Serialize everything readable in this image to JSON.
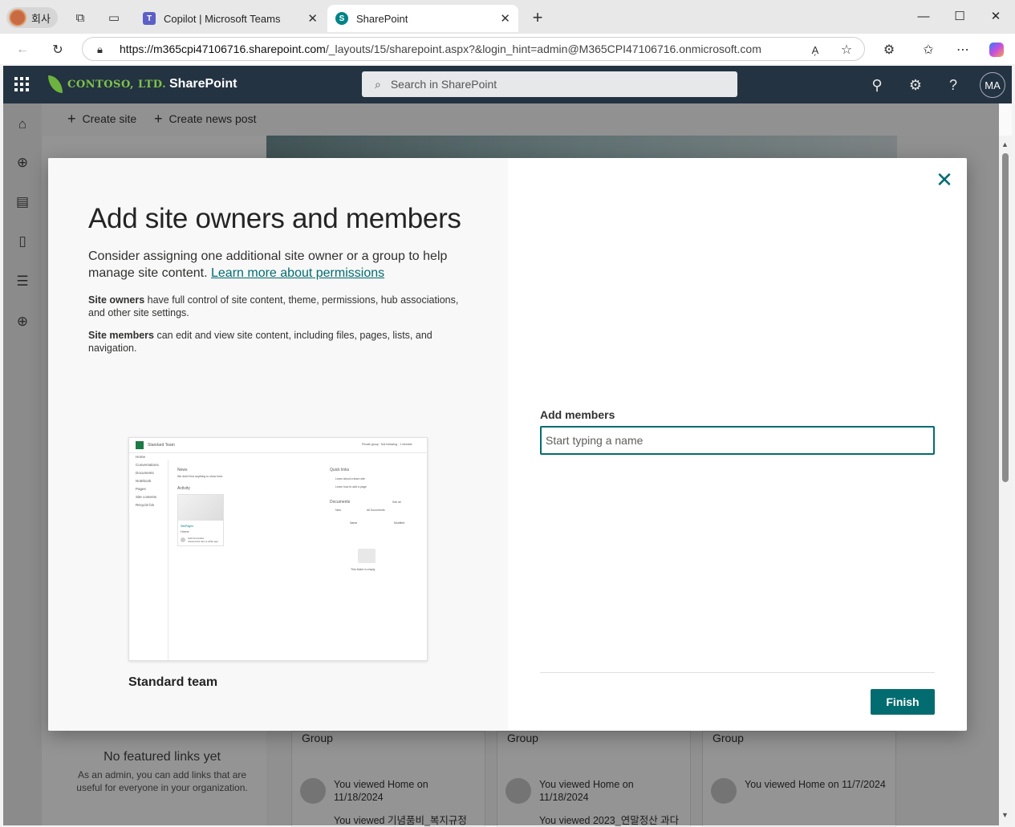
{
  "browser": {
    "profile_label": "회사",
    "tabs": [
      {
        "title": "Copilot | Microsoft Teams",
        "icon": "teams-icon",
        "active": false
      },
      {
        "title": "SharePoint",
        "icon": "sharepoint-icon",
        "active": true
      }
    ],
    "url_host": "https://m365cpi47106716.sharepoint.com",
    "url_path": "/_layouts/15/sharepoint.aspx?&login_hint=admin@M365CPI47106716.onmicrosoft.com"
  },
  "suitebar": {
    "logo_text": "CONTOSO, LTD.",
    "app_name": "SharePoint",
    "search_placeholder": "Search in SharePoint",
    "user_initials": "MA"
  },
  "commandbar": {
    "create_site": "Create site",
    "create_news": "Create news post"
  },
  "background": {
    "no_featured_title": "No featured links yet",
    "no_featured_desc": "As an admin, you can add links that are useful for everyone in your organization.",
    "cards": [
      {
        "label": "Group",
        "activity": "You viewed Home on 11/18/2024",
        "activity2": "You viewed 기념품비_복지규정"
      },
      {
        "label": "Group",
        "activity": "You viewed Home on 11/18/2024",
        "activity2": "You viewed 2023_연말정산 과다"
      },
      {
        "label": "Group",
        "activity": "You viewed Home on 11/7/2024",
        "activity2": ""
      }
    ]
  },
  "dialog": {
    "title": "Add site owners and members",
    "intro": "Consider assigning one additional site owner or a group to help manage site content.",
    "learn_more": "Learn more about permissions",
    "owners_term": "Site owners",
    "owners_desc": "have full control of site content, theme, permissions, hub associations, and other site settings.",
    "members_term": "Site members",
    "members_desc": "can edit and view site content, including files, pages, lists, and navigation.",
    "template_name": "Standard team",
    "preview": {
      "site_name": "Standard Team",
      "header_actions": "Private group  ·  Not following  ·  1 member",
      "nav": [
        "Home",
        "Conversations",
        "Documents",
        "Notebook",
        "Pages",
        "Site contents",
        "Recycle bin"
      ],
      "news_title": "News",
      "news_empty": "We didn't find anything to show here.",
      "activity_title": "Activity",
      "quicklinks_title": "Quick links",
      "quicklinks": [
        "Learn about a team site",
        "Learn how to add a page"
      ],
      "documents_title": "Documents",
      "see_all": "See all",
      "doc_new": "New",
      "doc_view": "All Documents",
      "col_name": "Name",
      "col_modified": "Modified",
      "activity_card_label": "SitePages",
      "activity_card_title": "Home",
      "activity_user": "Gail Fernandez",
      "activity_note": "Viewed this item a while ago",
      "folder_empty": "This folder is empty"
    },
    "add_members_label": "Add members",
    "add_members_placeholder": "Start typing a name",
    "finish_label": "Finish"
  },
  "colors": {
    "accent": "#036c70",
    "suitebar": "#233342"
  }
}
